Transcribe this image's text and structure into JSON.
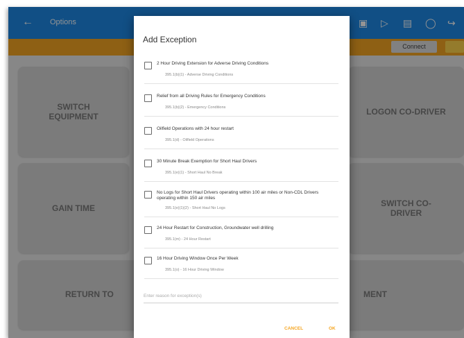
{
  "header": {
    "title": "Options"
  },
  "alert": {
    "text": "",
    "connect_label": "Connect"
  },
  "tiles": {
    "switch_equipment": "SWITCH\nEQUIPMENT",
    "logon_co_driver": "LOGON CO-DRIVER",
    "gain_time": "GAIN TIME",
    "switch_co_driver": "SWITCH CO-\nDRIVER",
    "return_to": "RETURN TO",
    "ment": "MENT"
  },
  "dialog": {
    "title": "Add Exception",
    "items": [
      {
        "title": "2 Hour Driving Extension for Adverse Driving Conditions",
        "subtitle": "395.1(b)(1) - Adverse Driving Conditions",
        "checked": false
      },
      {
        "title": "Relief from all Driving Rules for Emergency Conditions",
        "subtitle": "395.1(b)(2) - Emergency Conditions",
        "checked": false
      },
      {
        "title": "Oilfield Operations with 24 hour restart",
        "subtitle": "395.1(d) - Oilfield Operations",
        "checked": false
      },
      {
        "title": "30 Minute Break Exemption for Short Haul Drivers",
        "subtitle": "395.1(e)(1) - Short Haul No Break",
        "checked": false
      },
      {
        "title": "No Logs for Short Haul Drivers operating within 100 air miles or Non-CDL Drivers operating within 150 air miles",
        "subtitle": "395.1(e)(1)(2) - Short Haul No Logs",
        "checked": false
      },
      {
        "title": "24 Hour Restart for Construction, Groundwater well drilling",
        "subtitle": "395.1(m) - 24 Hour Restart",
        "checked": false
      },
      {
        "title": "16 Hour Driving Window Once Per Week",
        "subtitle": "395.1(o) - 16 Hour Driving Window",
        "checked": false
      }
    ],
    "reason_placeholder": "Enter reason for exception(s)",
    "cancel_label": "CANCEL",
    "ok_label": "OK"
  },
  "colors": {
    "accent": "#1e88e5",
    "warning": "#f5a623",
    "dialog_button": "#f5a623"
  }
}
